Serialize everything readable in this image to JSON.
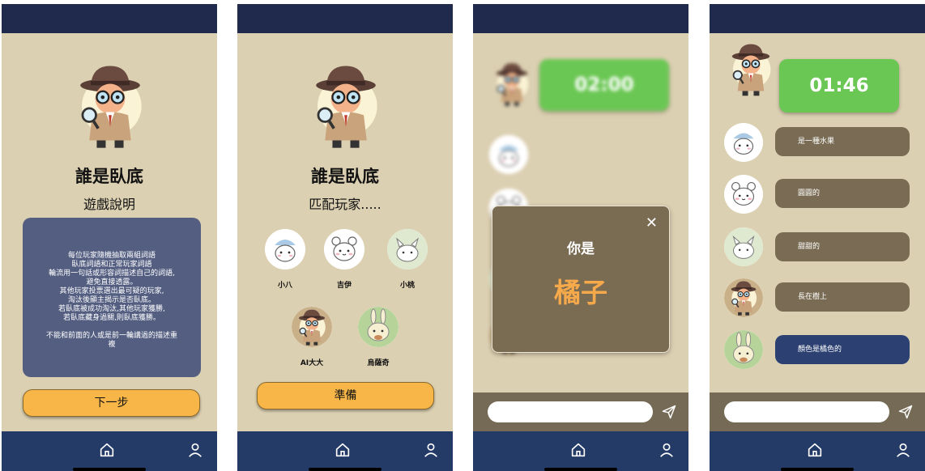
{
  "game": {
    "title": "誰是臥底"
  },
  "screen1": {
    "subtitle": "遊戲說明",
    "rules": "每位玩家隨機抽取兩組詞語\n臥底詞語和正常玩家詞語\n輪流用一句話或形容詞描述自己的詞語,\n避免直接透露。\n其他玩家投票選出最可疑的玩家,\n淘汰後顯主揭示是否臥底。\n若臥底被成功淘汰,其他玩家獲勝,\n若臥底藏身過關,則臥底獲勝。\n\n不能和前面的人或是前一輪講過的描述重\n複",
    "next_label": "下一步"
  },
  "screen2": {
    "subtitle": "匹配玩家.....",
    "players": [
      {
        "name": "小八"
      },
      {
        "name": "吉伊"
      },
      {
        "name": "小桃"
      },
      {
        "name": "AI大大"
      },
      {
        "name": "烏薩奇"
      }
    ],
    "ready_label": "準備"
  },
  "screen3": {
    "timer": "02:00",
    "modal": {
      "label": "你是",
      "word": "橘子",
      "close": "✕"
    }
  },
  "screen4": {
    "timer": "01:46",
    "messages": [
      {
        "text": "是一種水果"
      },
      {
        "text": "圓圓的"
      },
      {
        "text": "甜甜的"
      },
      {
        "text": "長在樹上"
      },
      {
        "text": "顏色是橘色的"
      }
    ]
  },
  "colors": {
    "background": "#dcd0b2",
    "top_bar": "#1f2a4c",
    "nav_bar": "#243a67",
    "button": "#f9b648",
    "timer": "#6bc754",
    "bubble": "#7a6c54",
    "bubble_me": "#2c4171",
    "word": "#f6a94b"
  },
  "icons": {
    "home": "home-icon",
    "profile": "user-icon",
    "send": "send-icon",
    "close": "close-icon"
  }
}
